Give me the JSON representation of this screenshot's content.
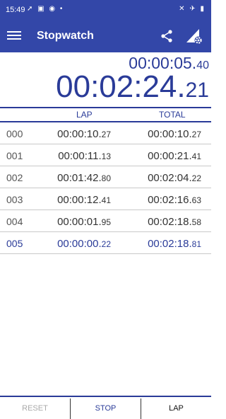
{
  "status_bar": {
    "time": "15:49",
    "left_icons": "➚ ▣ ◉ •",
    "right_icons": "✕ ✈ ▮"
  },
  "app_bar": {
    "title": "Stopwatch"
  },
  "current_lap_time": {
    "main": "00:00:05.",
    "centis": "40"
  },
  "total_time": {
    "main": "00:02:24.",
    "centis": "21"
  },
  "columns": {
    "lap": "LAP",
    "total": "TOTAL"
  },
  "laps": [
    {
      "index": "000",
      "lap": "00:00:10.",
      "lap_cs": "27",
      "total": "00:00:10.",
      "total_cs": "27"
    },
    {
      "index": "001",
      "lap": "00:00:11.",
      "lap_cs": "13",
      "total": "00:00:21.",
      "total_cs": "41"
    },
    {
      "index": "002",
      "lap": "00:01:42.",
      "lap_cs": "80",
      "total": "00:02:04.",
      "total_cs": "22"
    },
    {
      "index": "003",
      "lap": "00:00:12.",
      "lap_cs": "41",
      "total": "00:02:16.",
      "total_cs": "63"
    },
    {
      "index": "004",
      "lap": "00:00:01.",
      "lap_cs": "95",
      "total": "00:02:18.",
      "total_cs": "58"
    },
    {
      "index": "005",
      "lap": "00:00:00.",
      "lap_cs": "22",
      "total": "00:02:18.",
      "total_cs": "81"
    }
  ],
  "buttons": {
    "reset": "RESET",
    "stop": "STOP",
    "lap": "LAP"
  },
  "colors": {
    "primary": "#3347a8",
    "accent": "#2a3b98",
    "disabled": "#aaaaaa"
  }
}
